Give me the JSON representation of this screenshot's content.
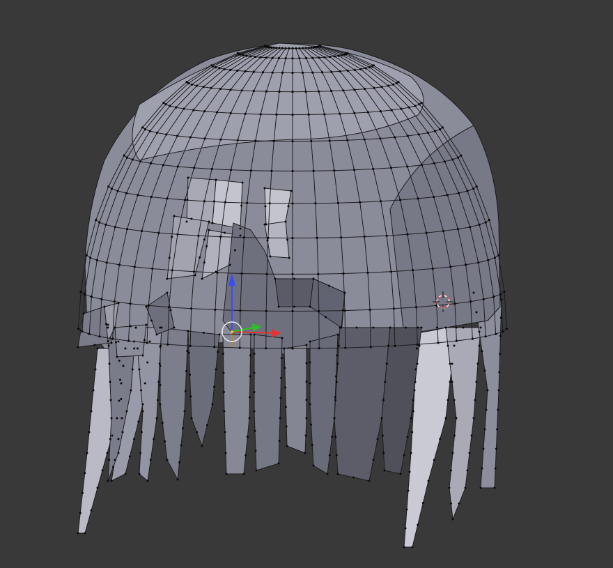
{
  "viewport": {
    "background": "#393939",
    "object": "hair-mesh",
    "mode": "edit-mode",
    "shading": "solid",
    "gizmo": "translate-manipulator",
    "cursor": "3d-cursor"
  },
  "colors": {
    "face_light": "#c2c3cd",
    "face_mid": "#9fa0ad",
    "face_base": "#898a98",
    "face_dark": "#6e6f7c",
    "face_darker": "#565763",
    "edge": "#1c1c20",
    "vertex": "#0a0a0a",
    "axis_x": "#e23434",
    "axis_y": "#28c228",
    "axis_z": "#3a4df5",
    "pivot": "#f0f0f0",
    "cursor_red": "#e03c3c",
    "cursor_white": "#f4f4f4"
  }
}
